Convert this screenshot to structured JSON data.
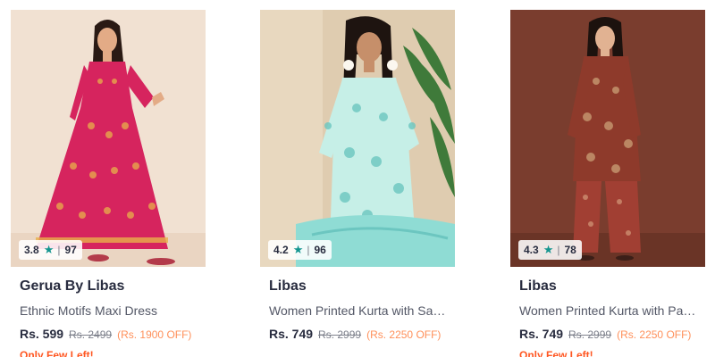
{
  "products": [
    {
      "brand": "Gerua By Libas",
      "name": "Ethnic Motifs Maxi Dress",
      "rating": "3.8",
      "rating_count": "97",
      "price": "Rs. 599",
      "mrp": "Rs. 2499",
      "discount": "(Rs. 1900 OFF)",
      "stock": "Only Few Left!",
      "image": {
        "background": "#f1e1d2",
        "garment": "#d6245e",
        "print": "#e8b04a"
      }
    },
    {
      "brand": "Libas",
      "name": "Women Printed Kurta with Sal…",
      "rating": "4.2",
      "rating_count": "96",
      "price": "Rs. 749",
      "mrp": "Rs. 2999",
      "discount": "(Rs. 2250 OFF)",
      "stock": "",
      "image": {
        "background": "#dfccb0",
        "garment": "#c6efe7",
        "print": "#6cc6c0"
      }
    },
    {
      "brand": "Libas",
      "name": "Women Printed Kurta with Pal…",
      "rating": "4.3",
      "rating_count": "78",
      "price": "Rs. 749",
      "mrp": "Rs. 2999",
      "discount": "(Rs. 2250 OFF)",
      "stock": "Only Few Left!",
      "image": {
        "background": "#7a3d2e",
        "garment": "#8e3a2b",
        "print": "#c79a72"
      }
    }
  ],
  "icons": {
    "rating": "star-icon"
  },
  "colors": {
    "star": "#14958f",
    "discount": "#ff905a",
    "stock": "#ff5722"
  }
}
